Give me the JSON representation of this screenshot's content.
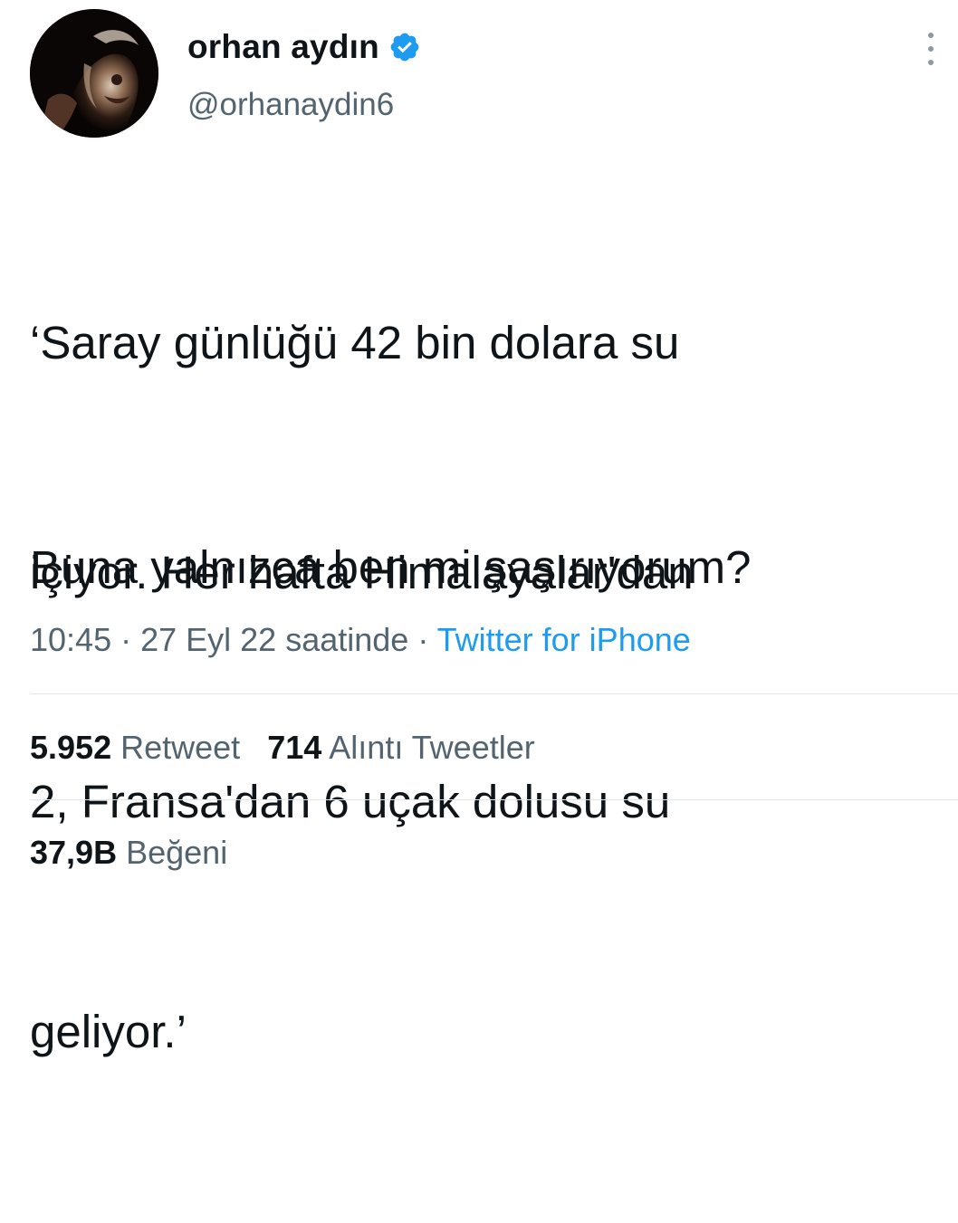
{
  "user": {
    "display_name": "orhan aydın",
    "handle": "@orhanaydin6",
    "verified_icon": "verified-badge-icon",
    "avatar_icon": "avatar-photo"
  },
  "tweet": {
    "lines": [
      "‘Saray günlüğü 42 bin dolara su",
      "içiyor. Her hafta Himalayalar'dan",
      "2, Fransa'dan 6 uçak dolusu su",
      "geliyor.’"
    ],
    "question": "Buna yalnızca ben mi şaşırıyorum?"
  },
  "meta": {
    "time": "10:45",
    "sep1": " · ",
    "date": "27 Eyl 22 saatinde",
    "sep2": " · ",
    "source": "Twitter for iPhone"
  },
  "stats": {
    "retweets_count": "5.952",
    "retweets_label": "Retweet",
    "quotes_count": "714",
    "quotes_label": "Alıntı Tweetler",
    "likes_count": "37,9B",
    "likes_label": "Beğeni"
  },
  "colors": {
    "text": "#0f1419",
    "secondary": "#536471",
    "link": "#1d9bf0",
    "verified": "#1d9bf0",
    "divider": "#e1e8ed"
  },
  "icons": {
    "more": "more-options-icon"
  }
}
